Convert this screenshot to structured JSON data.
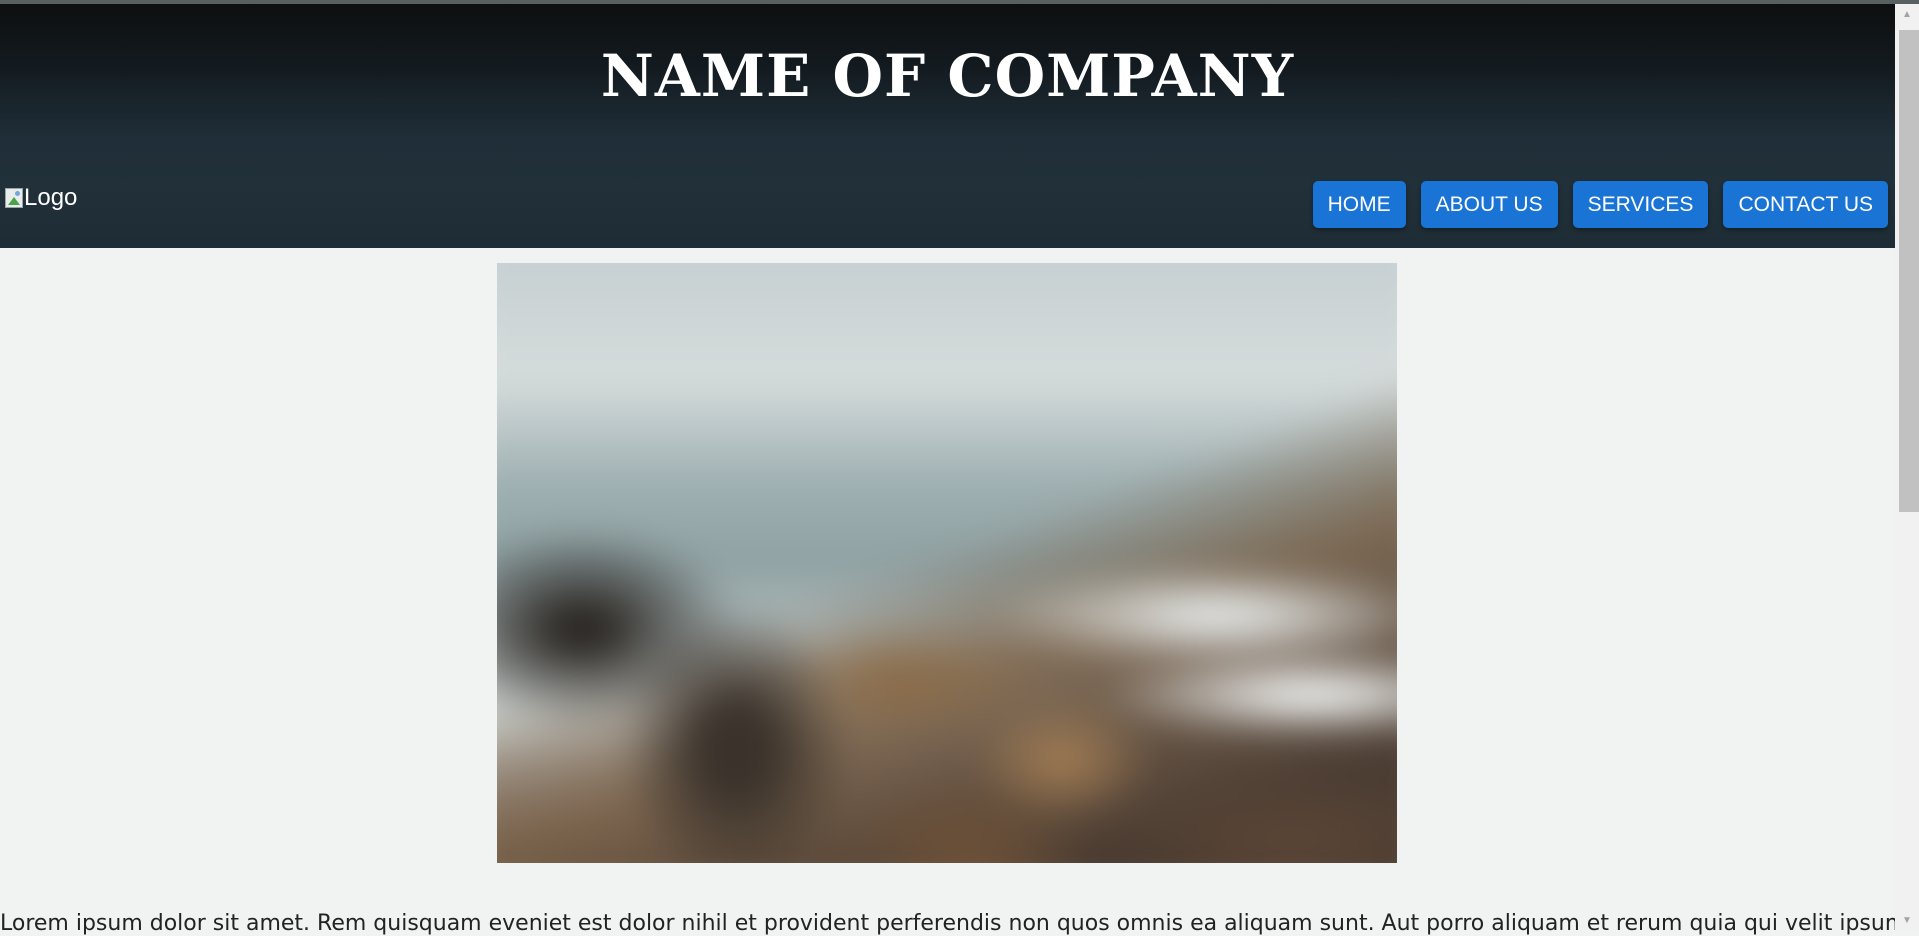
{
  "header": {
    "company_name": "NAME OF COMPANY",
    "logo_alt": "Logo"
  },
  "nav": {
    "items": [
      {
        "label": "HOME"
      },
      {
        "label": "ABOUT US"
      },
      {
        "label": "SERVICES"
      },
      {
        "label": "CONTACT US"
      }
    ]
  },
  "main": {
    "paragraph": "Lorem ipsum dolor sit amet. Rem quisquam eveniet est dolor nihil et provident perferendis non quos omnis ea aliquam sunt. Aut porro aliquam et rerum quia qui velit ipsum aut"
  },
  "colors": {
    "header_top": "#0d0f10",
    "header_bottom": "#1e2c35",
    "nav_button": "#1a74d6",
    "page_background": "#f1f3f2"
  },
  "icons": {
    "scroll_up": "scroll-up-arrow-icon",
    "scroll_down": "scroll-down-arrow-icon",
    "logo_placeholder": "broken-image-icon"
  }
}
